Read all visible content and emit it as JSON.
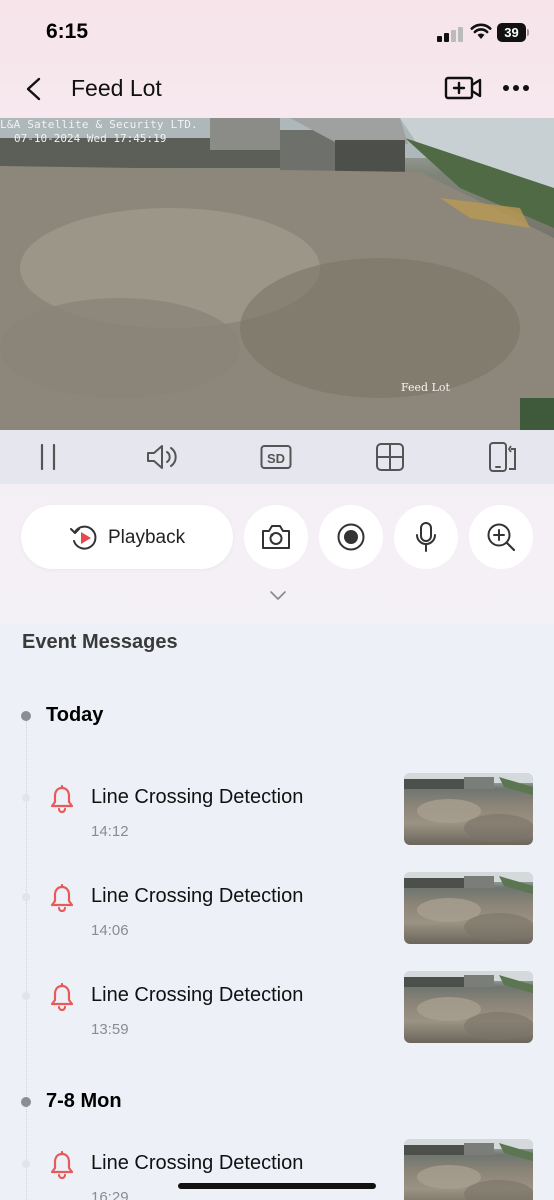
{
  "status_bar": {
    "time": "6:15",
    "battery": "39"
  },
  "header": {
    "title": "Feed Lot",
    "back_icon": "chevron-left-icon",
    "add_camera_icon": "video-add-icon",
    "more_icon": "ellipsis-icon"
  },
  "video": {
    "osd_company": "L&A Satellite & Security LTD.",
    "osd_datetime": "07-10-2024 Wed 17:45:19",
    "osd_camera_name": "Feed Lot"
  },
  "controls": {
    "items": [
      "pause-icon",
      "speaker-icon",
      "sd-quality-icon",
      "grid-view-icon",
      "rotate-phone-icon"
    ]
  },
  "actions": {
    "playback_label": "Playback",
    "buttons": [
      "camera-snapshot-icon",
      "record-icon",
      "microphone-icon",
      "zoom-in-icon"
    ]
  },
  "events": {
    "heading": "Event Messages",
    "groups": [
      {
        "date": "Today",
        "items": [
          {
            "title": "Line Crossing Detection",
            "time": "14:12"
          },
          {
            "title": "Line Crossing Detection",
            "time": "14:06"
          },
          {
            "title": "Line Crossing Detection",
            "time": "13:59"
          }
        ]
      },
      {
        "date": "7-8 Mon",
        "items": [
          {
            "title": "Line Crossing Detection",
            "time": "16:29"
          }
        ]
      }
    ]
  },
  "colors": {
    "bell": "#e85a5a",
    "playback_accent": "#e8474c"
  }
}
